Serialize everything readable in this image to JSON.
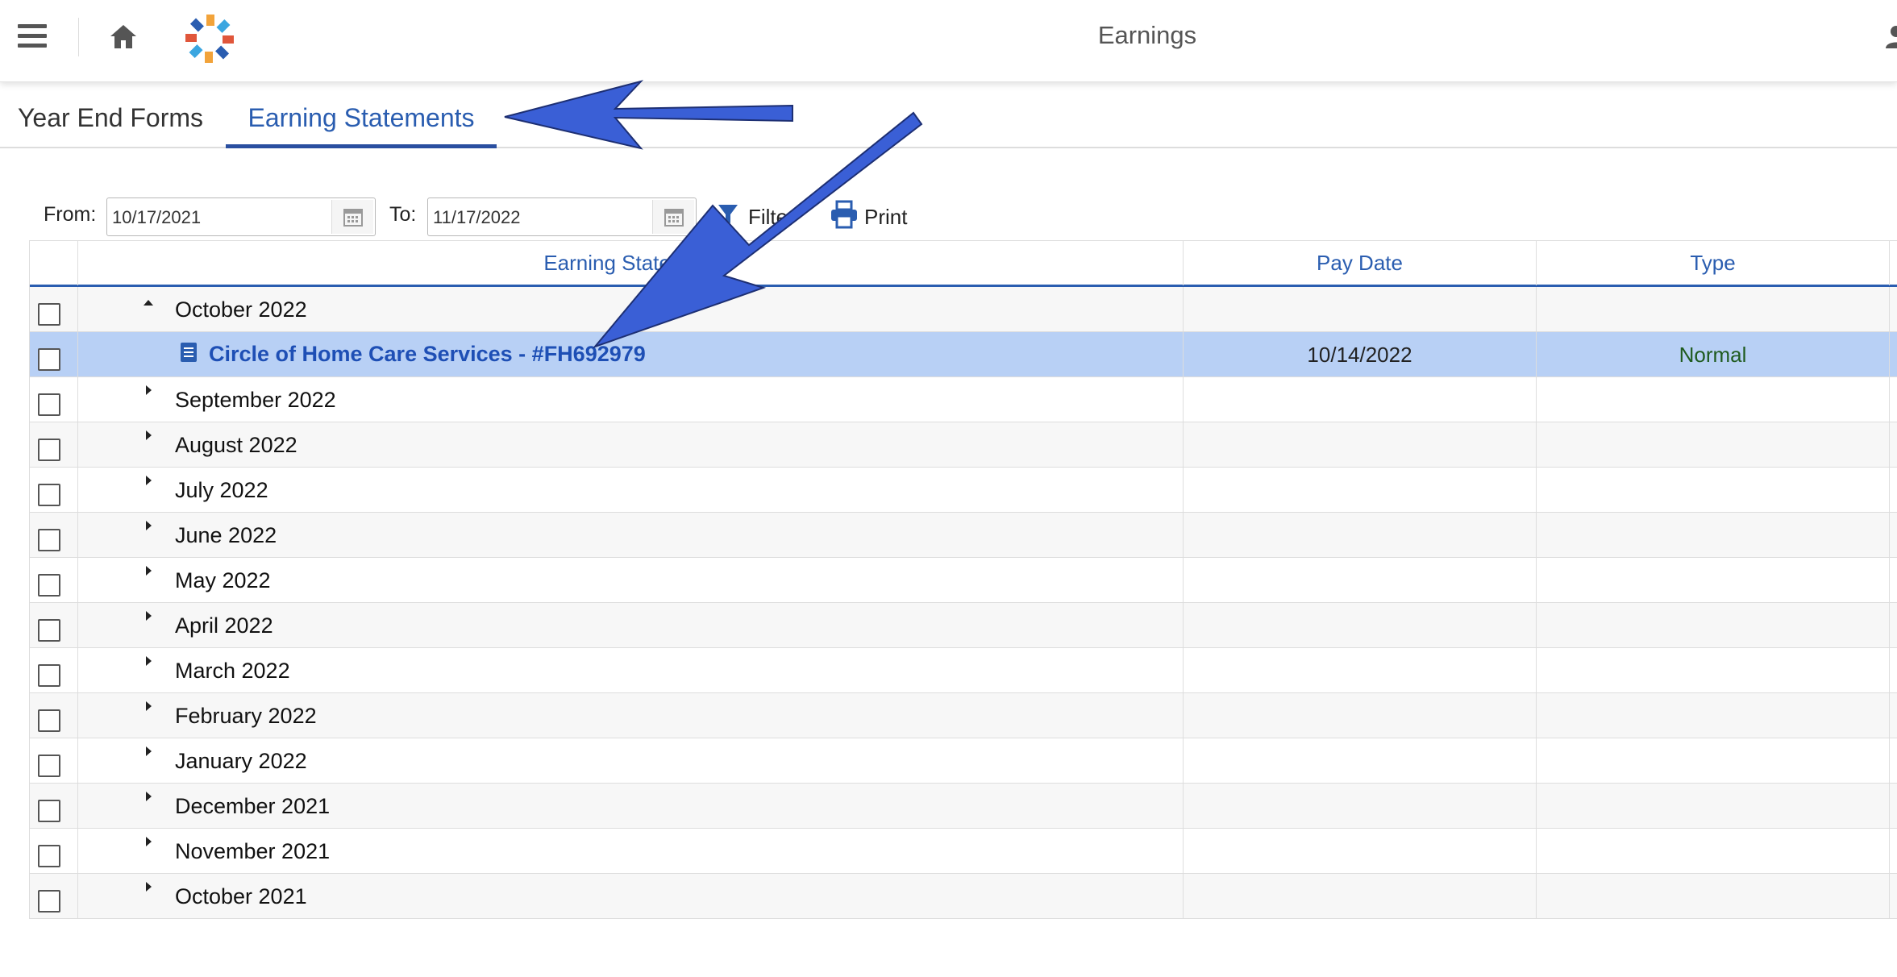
{
  "header": {
    "title": "Earnings",
    "menu_icon": "hamburger-menu-icon",
    "home_icon": "home-icon",
    "logo": "company-logo",
    "user_icon": "user-icon"
  },
  "tabs": [
    {
      "label": "Year End Forms",
      "active": false
    },
    {
      "label": "Earning Statements",
      "active": true
    }
  ],
  "toolbar": {
    "from_label": "From:",
    "from_value": "10/17/2021",
    "to_label": "To:",
    "to_value": "11/17/2022",
    "filter_label": "Filter",
    "print_label": "Print"
  },
  "grid": {
    "columns": [
      "Earning Statement",
      "Pay Date",
      "Type"
    ],
    "rows": [
      {
        "kind": "group",
        "label": "October 2022",
        "expanded": true
      },
      {
        "kind": "item",
        "label": "Circle of Home Care Services - #FH692979",
        "pay_date": "10/14/2022",
        "type": "Normal",
        "selected": true
      },
      {
        "kind": "group",
        "label": "September 2022"
      },
      {
        "kind": "group",
        "label": "August 2022"
      },
      {
        "kind": "group",
        "label": "July 2022"
      },
      {
        "kind": "group",
        "label": "June 2022"
      },
      {
        "kind": "group",
        "label": "May 2022"
      },
      {
        "kind": "group",
        "label": "April 2022"
      },
      {
        "kind": "group",
        "label": "March 2022"
      },
      {
        "kind": "group",
        "label": "February 2022"
      },
      {
        "kind": "group",
        "label": "January 2022"
      },
      {
        "kind": "group",
        "label": "December 2021"
      },
      {
        "kind": "group",
        "label": "November 2021"
      },
      {
        "kind": "group",
        "label": "October 2021"
      }
    ]
  },
  "colors": {
    "accent": "#2a5db0",
    "tab_underline": "#2a4fa0",
    "selected_row": "#b8d0f5",
    "link": "#1e4fb5",
    "type_text": "#1f5b1f",
    "annotation_arrow": "#3a5fd6"
  }
}
